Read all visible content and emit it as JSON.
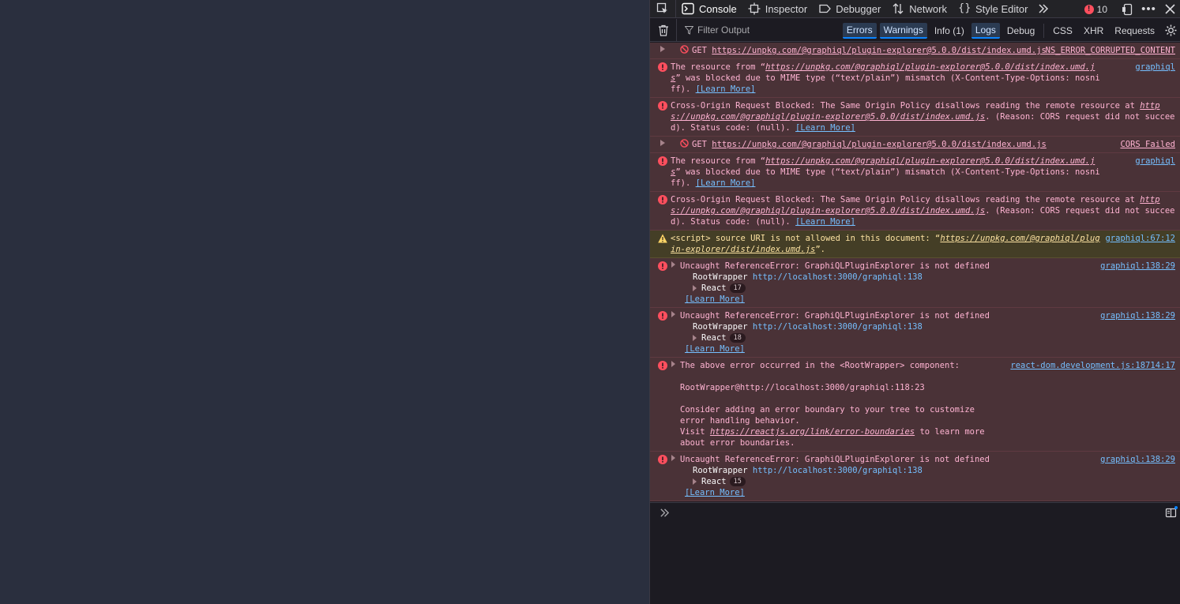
{
  "tabs": [
    {
      "label": "Console",
      "selected": true
    },
    {
      "label": "Inspector"
    },
    {
      "label": "Debugger"
    },
    {
      "label": "Network"
    },
    {
      "label": "Style Editor"
    }
  ],
  "error_count": "10",
  "toolbar": {
    "filter_placeholder": "Filter Output",
    "filters": [
      "Errors",
      "Warnings",
      "Info (1)",
      "Logs",
      "Debug",
      "CSS",
      "XHR",
      "Requests"
    ]
  },
  "messages": {
    "m1": {
      "method": "GET",
      "url": "https://unpkg.com/@graphiql/plugin-explorer@5.0.0/dist/index.umd.js",
      "src": "NS_ERROR_CORRUPTED_CONTENT"
    },
    "m2": {
      "pre": "The resource from “",
      "url": "https://unpkg.com/@graphiql/plugin-explorer@5.0.0/dist/index.umd.js",
      "post": "” was blocked due to MIME type (“text/plain”) mismatch (X-Content-Type-Options: nosniff).",
      "learn": "[Learn More]",
      "src": "graphiql"
    },
    "m3": {
      "pre": "Cross-Origin Request Blocked: The Same Origin Policy disallows reading the remote resource at ",
      "url": "https://unpkg.com/@graphiql/plugin-explorer@5.0.0/dist/index.umd.js",
      "post": ". (Reason: CORS request did not succeed). Status code: (null).",
      "learn": "[Learn More]"
    },
    "m4": {
      "method": "GET",
      "url": "https://unpkg.com/@graphiql/plugin-explorer@5.0.0/dist/index.umd.js",
      "src": "CORS Failed"
    },
    "m5": {
      "pre": "The resource from “",
      "url": "https://unpkg.com/@graphiql/plugin-explorer@5.0.0/dist/index.umd.js",
      "post": "” was blocked due to MIME type (“text/plain”) mismatch (X-Content-Type-Options: nosniff).",
      "learn": "[Learn More]",
      "src": "graphiql"
    },
    "m6": {
      "pre": "Cross-Origin Request Blocked: The Same Origin Policy disallows reading the remote resource at ",
      "url": "https://unpkg.com/@graphiql/plugin-explorer@5.0.0/dist/index.umd.js",
      "post": ". (Reason: CORS request did not succeed). Status code: (null).",
      "learn": "[Learn More]"
    },
    "m7": {
      "pre": "<script> source URI is not allowed in this document: “",
      "url": "https://unpkg.com/@graphiql/plugin-explorer/dist/index.umd.js",
      "post": "”.",
      "src": "graphiql:67:12"
    },
    "m8": {
      "text": "Uncaught ReferenceError: GraphiQLPluginExplorer is not defined",
      "frame": "RootWrapper",
      "frame_url": "http://localhost:3000/graphiql:138",
      "react": "React",
      "react_count": "17",
      "learn": "[Learn More]",
      "src": "graphiql:138:29"
    },
    "m9": {
      "text": "Uncaught ReferenceError: GraphiQLPluginExplorer is not defined",
      "frame": "RootWrapper",
      "frame_url": "http://localhost:3000/graphiql:138",
      "react": "React",
      "react_count": "18",
      "learn": "[Learn More]",
      "src": "graphiql:138:29"
    },
    "m10": {
      "line1": "The above error occurred in the <RootWrapper> component:",
      "line2": "RootWrapper@http://localhost:3000/graphiql:118:23",
      "line3": "Consider adding an error boundary to your tree to customize error handling behavior.",
      "line4_pre": "Visit ",
      "line4_url": "https://reactjs.org/link/error-boundaries",
      "line4_post": " to learn more about error boundaries.",
      "src": "react-dom.development.js:18714:17"
    },
    "m11": {
      "text": "Uncaught ReferenceError: GraphiQLPluginExplorer is not defined",
      "frame": "RootWrapper",
      "frame_url": "http://localhost:3000/graphiql:138",
      "react": "React",
      "react_count": "15",
      "learn": "[Learn More]",
      "src": "graphiql:138:29"
    }
  },
  "colors": {
    "error_bg": "#4a3237",
    "warn_bg": "#443e26",
    "accent": "#0a84ff",
    "error_dot": "#ff4f5e"
  }
}
